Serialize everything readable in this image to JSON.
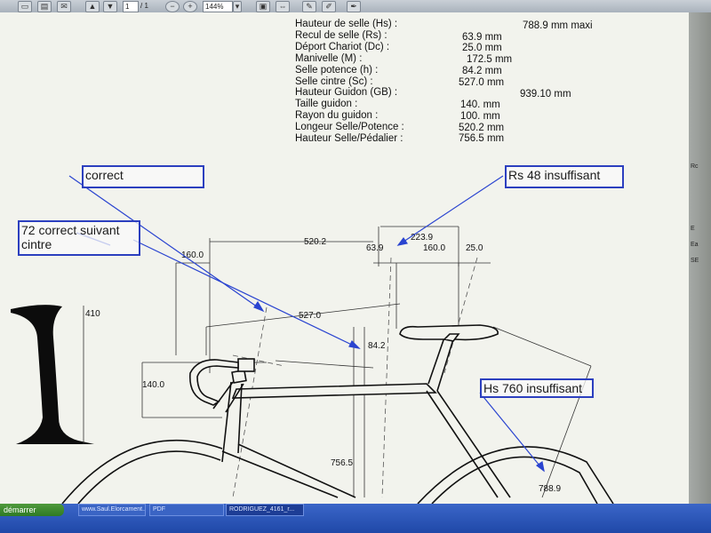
{
  "toolbar": {
    "page_current": "1",
    "page_total": "/ 1",
    "zoom_value": "144%"
  },
  "specs": [
    {
      "label": "Hauteur de selle (Hs) :",
      "value": "788.9 mm maxi"
    },
    {
      "label": "Recul de selle (Rs) :",
      "value": "63.9 mm"
    },
    {
      "label": "Déport Chariot  (Dc) :",
      "value": "25.0 mm"
    },
    {
      "label": "Manivelle (M) :",
      "value": "172.5 mm"
    },
    {
      "label": "Selle potence (h) :",
      "value": "84.2 mm"
    },
    {
      "label": "Selle cintre (Sc) :",
      "value": "527.0 mm"
    },
    {
      "label": "Hauteur Guidon (GB) :",
      "value": "939.10 mm"
    },
    {
      "label": "Taille guidon :",
      "value": "140. mm"
    },
    {
      "label": "Rayon du guidon :",
      "value": "100. mm"
    },
    {
      "label": "Longeur Selle/Potence :",
      "value": "520.2 mm"
    },
    {
      "label": "Hauteur Selle/Pédalier :",
      "value": "756.5 mm"
    }
  ],
  "annotations": {
    "correct": "correct",
    "rs48": "Rs 48 insuffisant",
    "seventy_two": "72 correct suivant cintre",
    "hs760": "Hs 760 insuffisant"
  },
  "dimensions": {
    "d223": "223.9",
    "d520": "520.2",
    "d63": "63.9",
    "d160a": "160.0",
    "d25": "25.0",
    "d160b": "160.0",
    "d527": "527.0",
    "d410": "410",
    "d842": "84.2",
    "d140": "140.0",
    "d7565": "756.5",
    "d7889": "788.9"
  },
  "right_panel": [
    "Rc",
    "E",
    "Ea",
    "SE"
  ],
  "taskbar": {
    "start_label": "démarrer",
    "tasks": [
      "www.Saul.Elorcament...",
      "PDF",
      "RODRIGUEZ_4161_r..."
    ]
  }
}
